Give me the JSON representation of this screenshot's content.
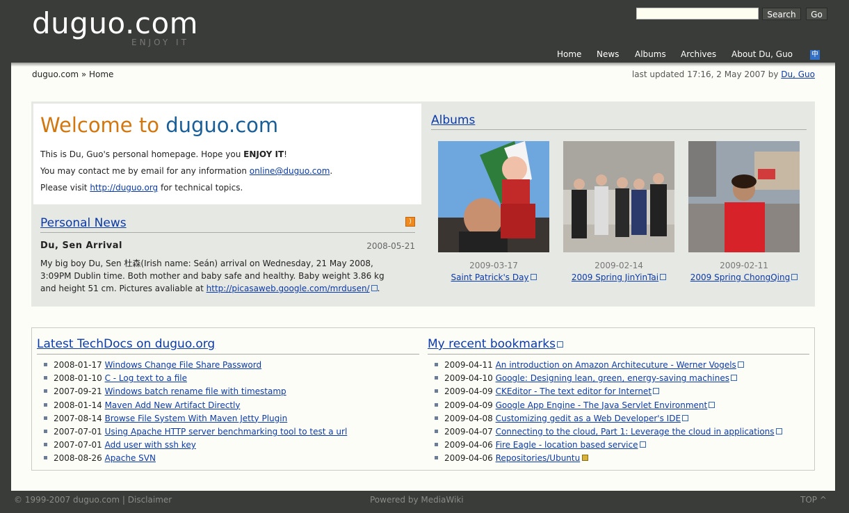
{
  "header": {
    "logo": "duguo.com",
    "tagline": "ENJOY IT",
    "search_placeholder": "",
    "search_button": "Search",
    "go_button": "Go",
    "nav": [
      "Home",
      "News",
      "Albums",
      "Archives",
      "About Du, Guo"
    ],
    "lang_label": "中"
  },
  "breadcrumb": "duguo.com » Home",
  "updated": {
    "text": "last updated 17:16, 2 May 2007 by",
    "author": "Du, Guo"
  },
  "welcome": {
    "title_a": "Welcome to",
    "title_b": "duguo.com",
    "line1_a": "This is Du, Guo's personal homepage. Hope you",
    "line1_b": "ENJOY IT",
    "line1_c": "!",
    "line2_a": "You may contact me by email for any information",
    "line2_link": "online@duguo.com",
    "line2_c": ".",
    "line3_a": "Please visit",
    "line3_link": "http://duguo.org",
    "line3_c": "for technical topics."
  },
  "news": {
    "heading": "Personal News",
    "title": "Du, Sen Arrival",
    "date": "2008-05-21",
    "body": "My big boy Du, Sen 杜森(Irish name: Seán) arrival on Wednesday, 21 May 2008, 3:09PM Dublin time. Both mother and baby safe and healthy. Baby weight 3.86 kg and height 51 cm. Pictures avaliable at",
    "link": "http://picasaweb.google.com/mrdusen/",
    "end": "."
  },
  "albums": {
    "heading": "Albums",
    "items": [
      {
        "date": "2009-03-17",
        "caption": "Saint Patrick's Day"
      },
      {
        "date": "2009-02-14",
        "caption": "2009 Spring JinYinTai"
      },
      {
        "date": "2009-02-11",
        "caption": "2009 Spring ChongQing"
      }
    ]
  },
  "techdocs": {
    "heading": "Latest TechDocs on duguo.org",
    "items": [
      {
        "date": "2008-01-17",
        "title": "Windows Change File Share Password"
      },
      {
        "date": "2008-01-10",
        "title": "C - Log text to a file"
      },
      {
        "date": "2007-09-21",
        "title": "Windows batch rename file with timestamp"
      },
      {
        "date": "2008-01-14",
        "title": "Maven Add New Artifact Directly"
      },
      {
        "date": "2007-08-14",
        "title": "Browse File System With Maven Jetty Plugin"
      },
      {
        "date": "2007-07-01",
        "title": "Using Apache HTTP server benchmarking tool to test a url"
      },
      {
        "date": "2007-07-01",
        "title": "Add user with ssh key"
      },
      {
        "date": "2008-08-26",
        "title": "Apache SVN"
      }
    ]
  },
  "bookmarks": {
    "heading": "My recent bookmarks",
    "items": [
      {
        "date": "2009-04-11",
        "title": "An introduction on Amazon Architecuture - Werner Vogels"
      },
      {
        "date": "2009-04-10",
        "title": "Google: Designing lean, green, energy-saving machines"
      },
      {
        "date": "2009-04-09",
        "title": "CKEditor - The text editor for Internet"
      },
      {
        "date": "2009-04-09",
        "title": "Google App Engine - The Java Servlet Environment"
      },
      {
        "date": "2009-04-08",
        "title": "Customizing gedit as a Web Developer's IDE"
      },
      {
        "date": "2009-04-07",
        "title": "Connecting to the cloud, Part 1: Leverage the cloud in applications"
      },
      {
        "date": "2009-04-06",
        "title": "Fire Eagle - location based service"
      },
      {
        "date": "2009-04-06",
        "title": "Repositories/Ubuntu"
      }
    ]
  },
  "footer": {
    "copyright": "© 1999-2007 duguo.com",
    "disclaimer": "| Disclaimer",
    "powered": "Powered by MediaWiki",
    "top": "TOP ^"
  },
  "colors": {
    "header_bg": "#3a3c39",
    "accent_orange": "#d2770f",
    "accent_blue": "#1a5e98",
    "link": "#0b3aa8"
  }
}
